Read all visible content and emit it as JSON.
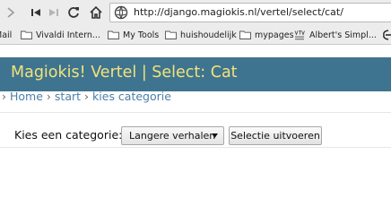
{
  "browser": {
    "url": "http://django.magiokis.nl/vertel/select/cat/"
  },
  "bookmarks": [
    {
      "label": "Mail",
      "icon": "none"
    },
    {
      "label": "Vivaldi Intern...",
      "icon": "folder-icon"
    },
    {
      "label": "My Tools",
      "icon": "folder-icon"
    },
    {
      "label": "huishoudelijk",
      "icon": "folder-icon"
    },
    {
      "label": "mypages",
      "icon": "folder-icon"
    },
    {
      "label": "Albert's Simpl...",
      "icon": "vtv-logo-icon"
    }
  ],
  "site": {
    "title": "Magiokis! Vertel | Select: Cat"
  },
  "breadcrumb": {
    "items": [
      "Home",
      "start",
      "kies categorie"
    ]
  },
  "form": {
    "label": "Kies een categorie:",
    "select_value": "Langere verhalen",
    "submit_label": "Selectie uitvoeren"
  },
  "colors": {
    "header_bg": "#3e7490",
    "title_text": "#f3e37a",
    "link": "#4d7fa8"
  }
}
